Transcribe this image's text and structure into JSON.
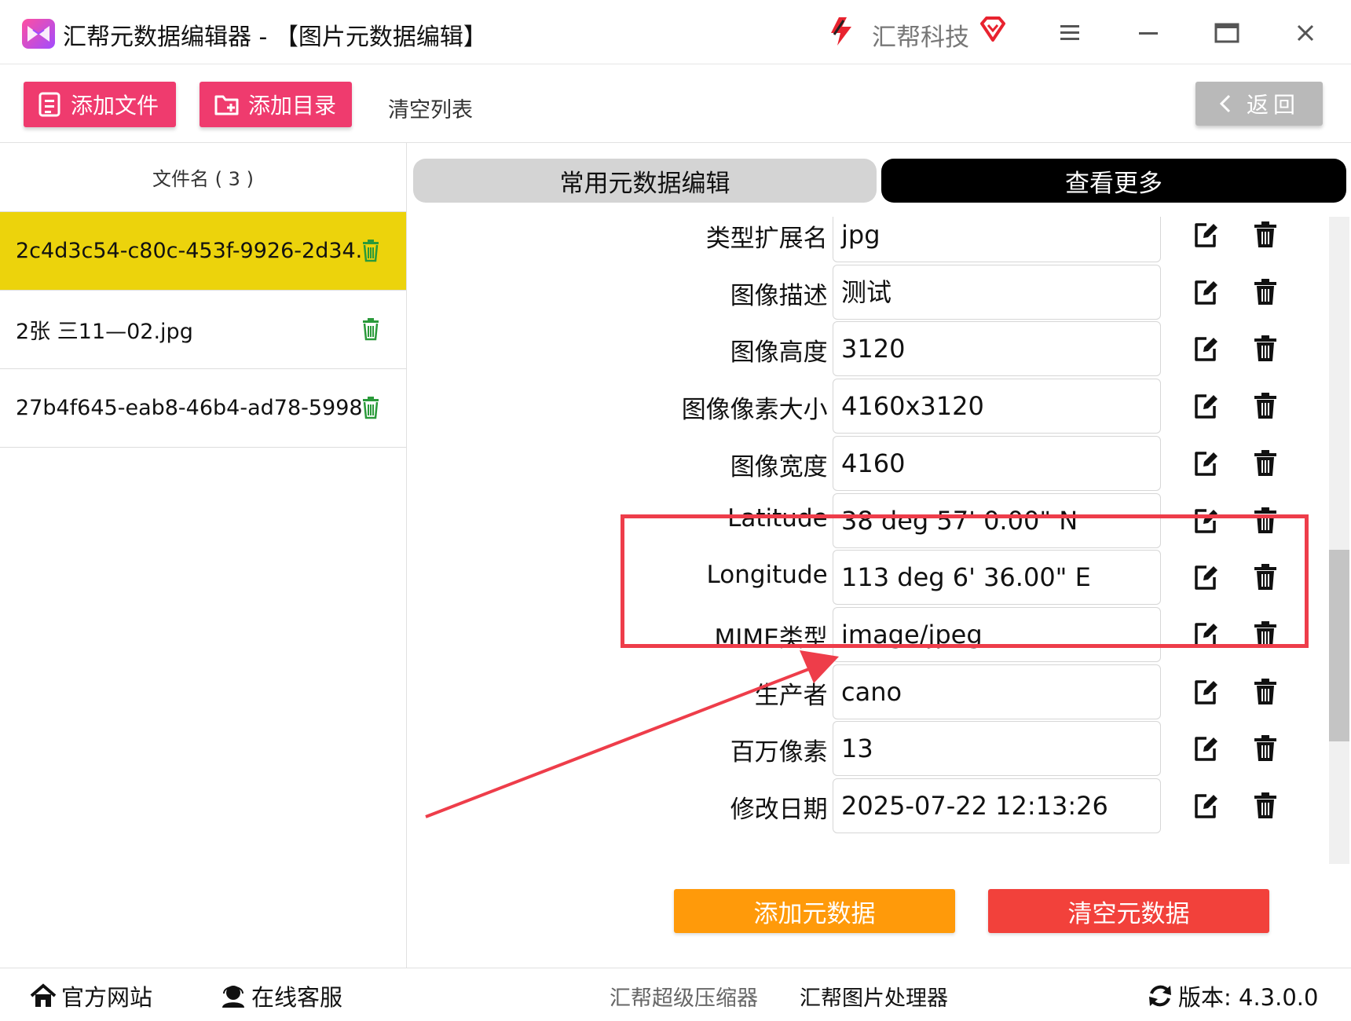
{
  "window": {
    "title": "汇帮元数据编辑器 - 【图片元数据编辑】",
    "brand": "汇帮科技",
    "icons": {
      "app": "app-logo-icon",
      "brand": "brand-logo-icon",
      "vip": "vip-diamond-icon",
      "menu": "hamburger-menu-icon",
      "minimize": "minimize-icon",
      "maximize": "maximize-icon",
      "close": "close-icon"
    }
  },
  "toolbar": {
    "add_file": "添加文件",
    "add_dir": "添加目录",
    "clear_list": "清空列表",
    "back": "返回",
    "accent_color": "#ef3b6e"
  },
  "file_list": {
    "header": "文件名 ( 3 )",
    "items": [
      {
        "name": "2c4d3c54-c80c-453f-9926-2d34...",
        "selected": true
      },
      {
        "name": "2张 三11—02.jpg",
        "selected": false
      },
      {
        "name": "27b4f645-eab8-46b4-ad78-5998...",
        "selected": false
      }
    ],
    "selected_color": "#ecd30c"
  },
  "tabs": {
    "common": "常用元数据编辑",
    "more": "查看更多",
    "active": "more"
  },
  "fields": [
    {
      "label": "类型扩展名 :",
      "value": "jpg"
    },
    {
      "label": "图像描述 :",
      "value": "测试"
    },
    {
      "label": "图像高度 :",
      "value": "3120"
    },
    {
      "label": "图像像素大小 :",
      "value": "4160x3120"
    },
    {
      "label": "图像宽度 :",
      "value": "4160"
    },
    {
      "label": "Latitude :",
      "value": "38 deg 57' 0.00\" N"
    },
    {
      "label": "Longitude :",
      "value": "113 deg 6' 36.00\" E"
    },
    {
      "label": "MIME类型 :",
      "value": "image/jpeg"
    },
    {
      "label": "生产者 :",
      "value": "cano"
    },
    {
      "label": "百万像素 :",
      "value": "13"
    },
    {
      "label": "修改日期 :",
      "value": "2025-07-22 12:13:26"
    }
  ],
  "actions": {
    "add_metadata": "添加元数据",
    "clear_metadata": "清空元数据",
    "add_color": "#ff9a0a",
    "clear_color": "#f2413b"
  },
  "status_bar": {
    "official_site": "官方网站",
    "online_service": "在线客服",
    "compressor": "汇帮超级压缩器",
    "image_processor": "汇帮图片处理器",
    "version": "版本:  4.3.0.0"
  },
  "annotation": {
    "highlight_color": "#ee3d4a"
  }
}
